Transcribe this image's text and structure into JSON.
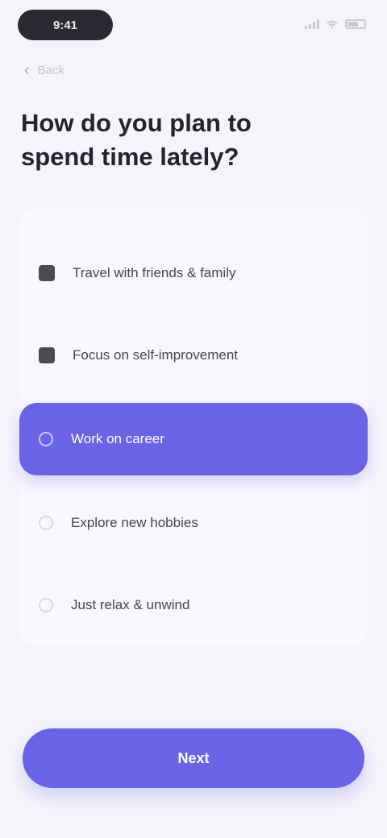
{
  "status_bar": {
    "time": "9:41"
  },
  "nav": {
    "back_label": "Back"
  },
  "question": "How do you plan to spend time lately?",
  "options": [
    {
      "label": "Travel with friends & family",
      "selected": false
    },
    {
      "label": "Focus on self-improvement",
      "selected": false
    },
    {
      "label": "Work on career",
      "selected": true
    },
    {
      "label": "Explore new hobbies",
      "selected": false
    },
    {
      "label": "Just relax & unwind",
      "selected": false
    }
  ],
  "cta_label": "Next",
  "colors": {
    "accent": "#6a63e6",
    "background": "#f4f4fb"
  }
}
